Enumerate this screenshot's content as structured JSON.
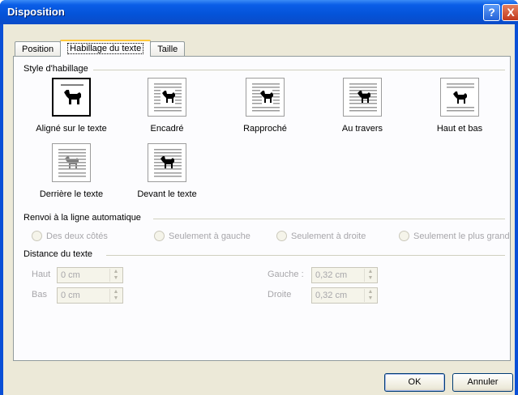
{
  "window": {
    "title": "Disposition",
    "help_label": "?",
    "close_label": "X"
  },
  "tabs": [
    {
      "label": "Position"
    },
    {
      "label": "Habillage du texte"
    },
    {
      "label": "Taille"
    }
  ],
  "style": {
    "heading": "Style d'habillage",
    "options": [
      {
        "label": "Aligné sur le texte",
        "icon": "inline-wrap-icon"
      },
      {
        "label": "Encadré",
        "icon": "square-wrap-icon"
      },
      {
        "label": "Rapproché",
        "icon": "tight-wrap-icon"
      },
      {
        "label": "Au travers",
        "icon": "through-wrap-icon"
      },
      {
        "label": "Haut et bas",
        "icon": "top-bottom-wrap-icon"
      },
      {
        "label": "Derrière le texte",
        "icon": "behind-text-icon"
      },
      {
        "label": "Devant le texte",
        "icon": "in-front-text-icon"
      }
    ]
  },
  "renvoi": {
    "heading": "Renvoi à la ligne automatique",
    "options": [
      {
        "label": "Des deux côtés"
      },
      {
        "label": "Seulement à gauche"
      },
      {
        "label": "Seulement à droite"
      },
      {
        "label": "Seulement le plus grand"
      }
    ]
  },
  "distance": {
    "heading": "Distance du texte",
    "haut": {
      "label": "Haut",
      "value": "0 cm"
    },
    "bas": {
      "label": "Bas",
      "value": "0 cm"
    },
    "gauche": {
      "label": "Gauche :",
      "value": "0,32 cm"
    },
    "droite": {
      "label": "Droite",
      "value": "0,32 cm"
    }
  },
  "buttons": {
    "ok": "OK",
    "cancel": "Annuler"
  },
  "colors": {
    "titlebar": "#0453d8",
    "dialog_bg": "#ece9d8",
    "tab_accent": "#ffc83c"
  }
}
